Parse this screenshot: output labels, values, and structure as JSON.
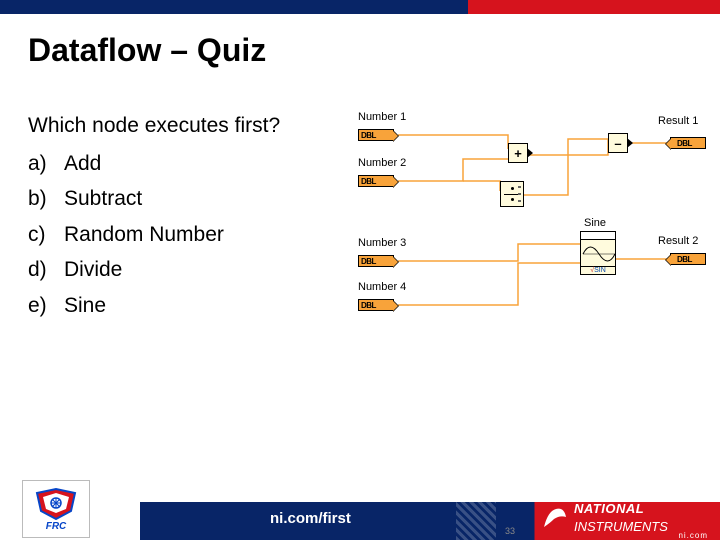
{
  "title": "Dataflow – Quiz",
  "question": "Which node executes first?",
  "options": [
    {
      "letter": "a)",
      "text": "Add"
    },
    {
      "letter": "b)",
      "text": "Subtract"
    },
    {
      "letter": "c)",
      "text": "Random Number"
    },
    {
      "letter": "d)",
      "text": "Divide"
    },
    {
      "letter": "e)",
      "text": "Sine"
    }
  ],
  "diagram": {
    "inputs": [
      "Number 1",
      "Number 2",
      "Number 3",
      "Number 4"
    ],
    "outputs": [
      "Result 1",
      "Result 2"
    ],
    "ops": {
      "add": "+",
      "subtract": "–",
      "sine_hdr": "Sine",
      "sine_ftr": "SIN"
    },
    "dbl": "DBL"
  },
  "footer": {
    "url": "ni.com/first",
    "page": "33",
    "frc": "FRC",
    "ni1": "NATIONAL",
    "ni2": "INSTRUMENTS",
    "ni_sub": "ni.com"
  }
}
